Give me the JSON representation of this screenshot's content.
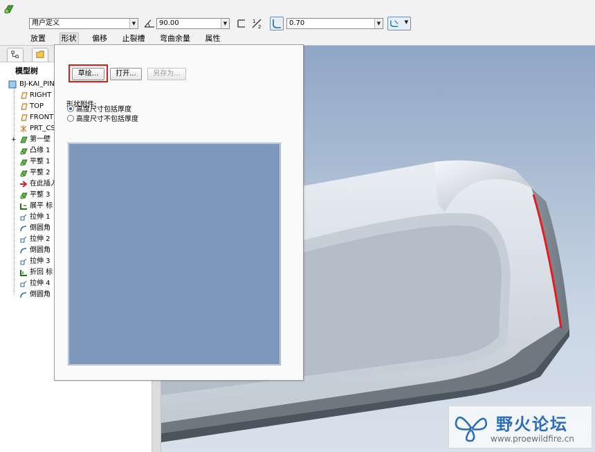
{
  "dashboard": {
    "profile_select": "用户定义",
    "angle_value": "90.00",
    "radius_value": "0.70",
    "tabs": [
      {
        "label": "放置",
        "active": false
      },
      {
        "label": "形状",
        "active": true
      },
      {
        "label": "偏移",
        "active": false
      },
      {
        "label": "止裂槽",
        "active": false
      },
      {
        "label": "弯曲余量",
        "active": false
      },
      {
        "label": "属性",
        "active": false
      }
    ]
  },
  "model_tree": {
    "title": "模型树",
    "items": [
      {
        "label": "BJ-KAI_PIN",
        "icon": "part-icon"
      },
      {
        "label": "RIGHT",
        "icon": "datum-plane-icon"
      },
      {
        "label": "TOP",
        "icon": "datum-plane-icon"
      },
      {
        "label": "FRONT",
        "icon": "datum-plane-icon"
      },
      {
        "label": "PRT_CS",
        "icon": "coordinate-system-icon"
      },
      {
        "label": "第一壁",
        "icon": "first-wall-icon"
      },
      {
        "label": "凸缘 1",
        "icon": "flange-icon"
      },
      {
        "label": "平整 1",
        "icon": "flat-wall-icon"
      },
      {
        "label": "平整 2",
        "icon": "flat-wall-icon"
      },
      {
        "label": "在此插入",
        "icon": "insert-here-arrow-icon"
      },
      {
        "label": "平整 3",
        "icon": "flat-wall-icon"
      },
      {
        "label": "展平 标",
        "icon": "unbend-icon"
      },
      {
        "label": "拉伸 1",
        "icon": "extrude-icon"
      },
      {
        "label": "倒圆角",
        "icon": "round-icon"
      },
      {
        "label": "拉伸 2",
        "icon": "extrude-icon"
      },
      {
        "label": "倒圆角",
        "icon": "round-icon"
      },
      {
        "label": "拉伸 3",
        "icon": "extrude-icon"
      },
      {
        "label": "折回 标",
        "icon": "bend-back-icon"
      },
      {
        "label": "拉伸 4",
        "icon": "extrude-icon"
      },
      {
        "label": "倒圆角",
        "icon": "round-icon"
      }
    ]
  },
  "shape_panel": {
    "sketch_button": "草绘...",
    "open_button": "打开...",
    "save_as_button": "另存为...",
    "option_title": "形状附件:",
    "options": [
      {
        "label": "高度尺寸包括厚度",
        "selected": true
      },
      {
        "label": "高度尺寸不包括厚度",
        "selected": false
      }
    ]
  },
  "watermark": {
    "title": "野火论坛",
    "url": "www.proewildfire.cn"
  },
  "colors": {
    "highlight_box": "#e01818",
    "edge_highlight": "#e81c1c",
    "preview_bg": "#7c97b9",
    "graphics_top": "#8fa6c5",
    "watermark_text": "#2a6fb8"
  }
}
